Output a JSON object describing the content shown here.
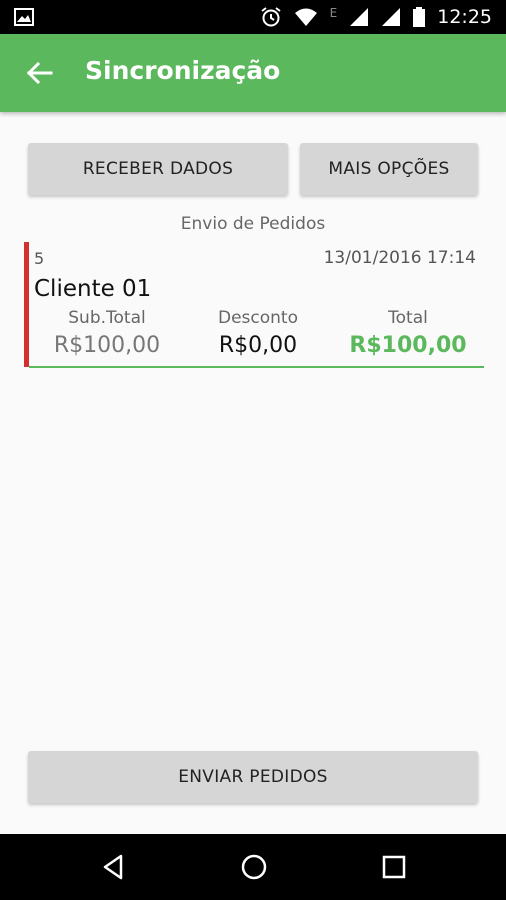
{
  "status_bar": {
    "time": "12:25",
    "network_type": "E",
    "icons": [
      "image-icon",
      "alarm-icon",
      "wifi-icon",
      "signal-icon",
      "signal-icon",
      "battery-icon"
    ]
  },
  "app_bar": {
    "title": "Sincronização",
    "back_icon": "arrow-back-icon"
  },
  "actions": {
    "receive_label": "RECEBER DADOS",
    "more_label": "MAIS OPÇÕES",
    "send_label": "ENVIAR PEDIDOS"
  },
  "section_title": "Envio de Pedidos",
  "orders": [
    {
      "number": "5",
      "date": "13/01/2016 17:14",
      "client": "Cliente 01",
      "subtotal_label": "Sub.Total",
      "subtotal": "R$100,00",
      "discount_label": "Desconto",
      "discount": "R$0,00",
      "total_label": "Total",
      "total": "R$100,00"
    }
  ],
  "colors": {
    "primary": "#5cb85c",
    "status_marker": "#d32f2f",
    "button_bg": "#d6d6d6"
  },
  "nav_bar": {
    "icons": [
      "back-triangle-icon",
      "home-circle-icon",
      "recents-square-icon"
    ]
  }
}
